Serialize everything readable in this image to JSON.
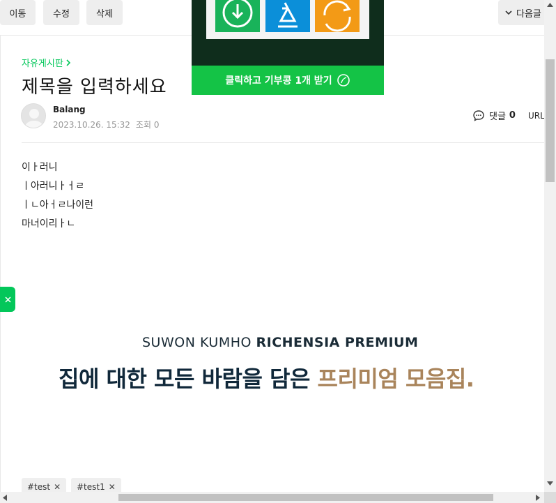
{
  "toolbar": {
    "move_label": "이동",
    "edit_label": "수정",
    "delete_label": "삭제",
    "next_label": "다음글"
  },
  "article": {
    "board_name": "자유게시판",
    "title": "제목을 입력하세요",
    "author": "Balang",
    "date": "2023.10.26. 15:32",
    "views": "조회 0",
    "comment_label": "댓글",
    "comment_count": "0",
    "url_label": "URL",
    "body_lines": [
      "이ㅏ러니",
      "ㅣ아러니ㅏㅓㄹ",
      "ㅣㄴ아ㅓㄹ나이런",
      "마너이리ㅏㄴ"
    ]
  },
  "banner": {
    "sub_plain": "SUWON KUMHO ",
    "sub_bold": "RICHENSIA PREMIUM",
    "main_plain": "집에 대한 모든 바람을 담은 ",
    "main_accent": "프리미엄 모음집."
  },
  "tags": [
    "#test",
    "#test1"
  ],
  "ad": {
    "cta_label": "클릭하고 기부콩 1개 받기"
  },
  "colors": {
    "brand_green": "#03c75a",
    "ad_bg": "#0f2d1c",
    "ad_cta": "#14c346",
    "banner_navy": "#10283a",
    "banner_gold": "#a9845b"
  },
  "icons": [
    "chevron-down-icon",
    "chevron-right-icon",
    "comment-icon",
    "close-icon",
    "download-icon",
    "recycle-icon",
    "refresh-icon",
    "bean-icon"
  ]
}
